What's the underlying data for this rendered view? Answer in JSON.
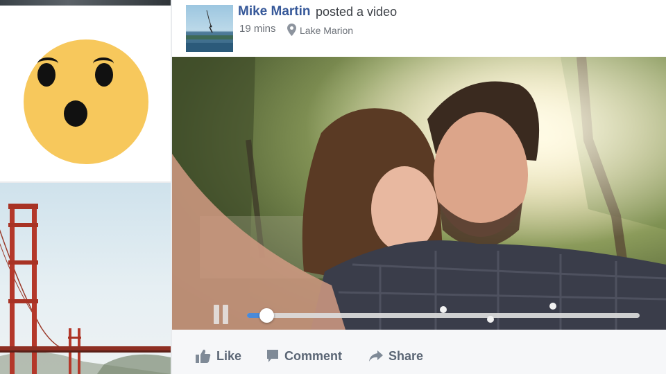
{
  "post": {
    "author": "Mike Martin",
    "action": "posted a video",
    "time": "19 mins",
    "location": "Lake Marion"
  },
  "video": {
    "progress": 0.05,
    "state": "playing",
    "markers": [
      0.5,
      0.62,
      0.78
    ]
  },
  "actions": {
    "like": "Like",
    "comment": "Comment",
    "share": "Share"
  },
  "colors": {
    "author": "#365899",
    "reaction_face": "#f7c85c",
    "progress_fill": "#4a8ad8"
  },
  "icons": {
    "reaction": "wow-reaction",
    "location": "map-pin-icon",
    "like": "thumbs-up-icon",
    "comment": "speech-bubble-icon",
    "share": "share-arrow-icon",
    "video_control": "pause-icon"
  }
}
